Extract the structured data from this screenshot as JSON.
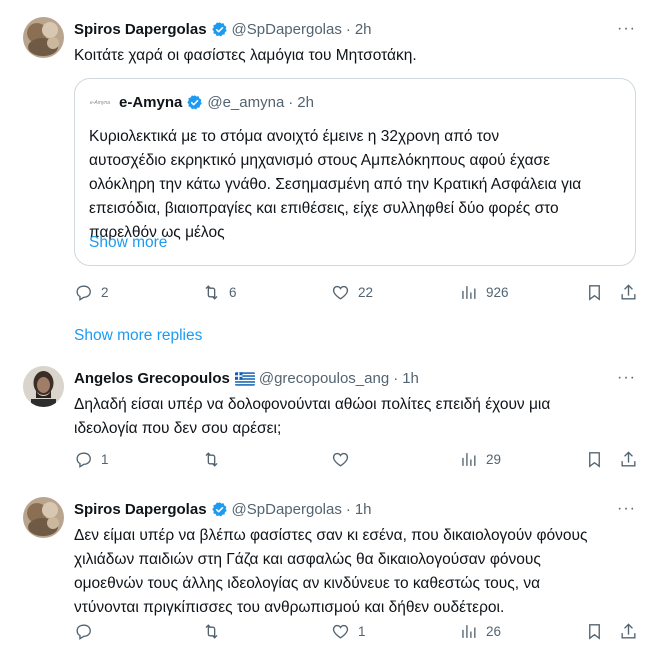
{
  "tweets": [
    {
      "author": "Spiros Dapergolas",
      "handle": "@SpDapergolas",
      "time": "2h",
      "text": "Κοιτάτε χαρά οι φασίστες λαμόγια του Μητσοτάκη.",
      "quote": {
        "logo_text": "e-Amyna",
        "author": "e-Amyna",
        "handle": "@e_amyna",
        "time": "2h",
        "lines": [
          "Κυριολεκτικά με το στόμα ανοιχτό έμεινε η 32χρονη από τον",
          "αυτοσχέδιο εκρηκτικό μηχανισμό στους Αμπελόκηπους αφού έχασε",
          "ολόκληρη την κάτω γνάθο. Σεσημασμένη από την Κρατική Ασφάλεια για",
          "επεισόδια,  βιαιοπραγίες και επιθέσεις, είχε συλληφθεί δύο φορές στο",
          "παρελθόν ως μέλος"
        ],
        "show_more": "Show more"
      },
      "replies": "2",
      "retweets": "6",
      "likes": "22",
      "views": "926"
    },
    {
      "author": "Angelos Grecopoulos",
      "handle": "@grecopoulos_ang",
      "time": "1h",
      "lines": [
        "Δηλαδή είσαι υπέρ να δολοφονούνται αθώοι πολίτες επειδή έχουν μια",
        "ιδεολογία που δεν σου αρέσει;"
      ],
      "replies": "1",
      "retweets": "",
      "likes": "",
      "views": "29"
    },
    {
      "author": "Spiros Dapergolas",
      "handle": "@SpDapergolas",
      "time": "1h",
      "lines": [
        "Δεν είμαι υπέρ να βλέπω φασίστες σαν κι εσένα, που δικαιολογούν φόνους",
        "χιλιάδων παιδιών στη Γάζα και ασφαλώς θα δικαιολογούσαν φόνους",
        "ομοεθνών τους άλλης ιδεολογίας αν κινδύνευε το καθεστώς τους, να",
        "ντύνονται πριγκίπισσες του ανθρωπισμού και δήθεν ουδέτεροι."
      ],
      "replies": "",
      "retweets": "",
      "likes": "1",
      "views": "26"
    }
  ],
  "show_more_replies": "Show more replies",
  "colors": {
    "accent": "#1d9bf0",
    "muted": "#536471",
    "border": "#cfd9de",
    "text": "#0f1419"
  }
}
